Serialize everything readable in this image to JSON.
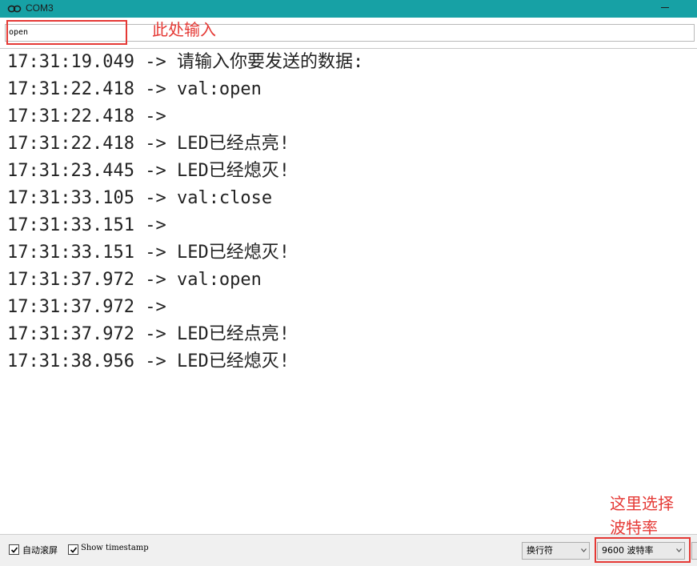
{
  "window": {
    "title": "COM3",
    "app_icon": "arduino-infinity-icon"
  },
  "send": {
    "value": "open"
  },
  "output_lines": [
    {
      "time": "17:31:19.049",
      "arrow": "->",
      "text": "请输入你要发送的数据:"
    },
    {
      "time": "17:31:22.418",
      "arrow": "->",
      "text": "val:open"
    },
    {
      "time": "17:31:22.418",
      "arrow": "->",
      "text": ""
    },
    {
      "time": "17:31:22.418",
      "arrow": "->",
      "text": "LED已经点亮!"
    },
    {
      "time": "17:31:23.445",
      "arrow": "->",
      "text": "LED已经熄灭!"
    },
    {
      "time": "17:31:33.105",
      "arrow": "->",
      "text": "val:close"
    },
    {
      "time": "17:31:33.151",
      "arrow": "->",
      "text": ""
    },
    {
      "time": "17:31:33.151",
      "arrow": "->",
      "text": "LED已经熄灭!"
    },
    {
      "time": "17:31:37.972",
      "arrow": "->",
      "text": "val:open"
    },
    {
      "time": "17:31:37.972",
      "arrow": "->",
      "text": ""
    },
    {
      "time": "17:31:37.972",
      "arrow": "->",
      "text": "LED已经点亮!"
    },
    {
      "time": "17:31:38.956",
      "arrow": "->",
      "text": "LED已经熄灭!"
    }
  ],
  "footer": {
    "autoscroll_label": "自动滚屏",
    "autoscroll_checked": true,
    "timestamp_label": "Show timestamp",
    "timestamp_checked": true,
    "line_ending": "换行符",
    "baud": "9600 波特率"
  },
  "annotations": {
    "input_note": "此处输入",
    "baud_note_line1": "这里选择",
    "baud_note_line2": "波特率"
  },
  "colors": {
    "titlebar": "#17a1a5",
    "annotation": "#e53935"
  }
}
